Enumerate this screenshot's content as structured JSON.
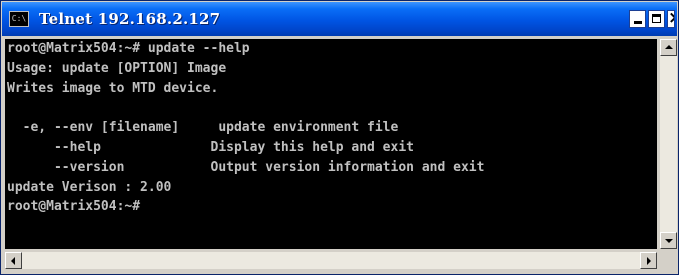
{
  "window": {
    "title": "Telnet 192.168.2.127",
    "icon": "cmd-icon",
    "icon_text": "C:\\"
  },
  "console": {
    "lines": [
      "root@Matrix504:~# update --help",
      "Usage: update [OPTION] Image",
      "Writes image to MTD device.",
      "",
      "  -e, --env [filename]     update environment file",
      "      --help              Display this help and exit",
      "      --version           Output version information and exit",
      "update Verison : 2.00",
      "root@Matrix504:~#"
    ],
    "foreground": "#c0c0c0",
    "background": "#000000"
  },
  "colors": {
    "titlebar": "#0054e3",
    "window_frame": "#d4d0c8"
  }
}
